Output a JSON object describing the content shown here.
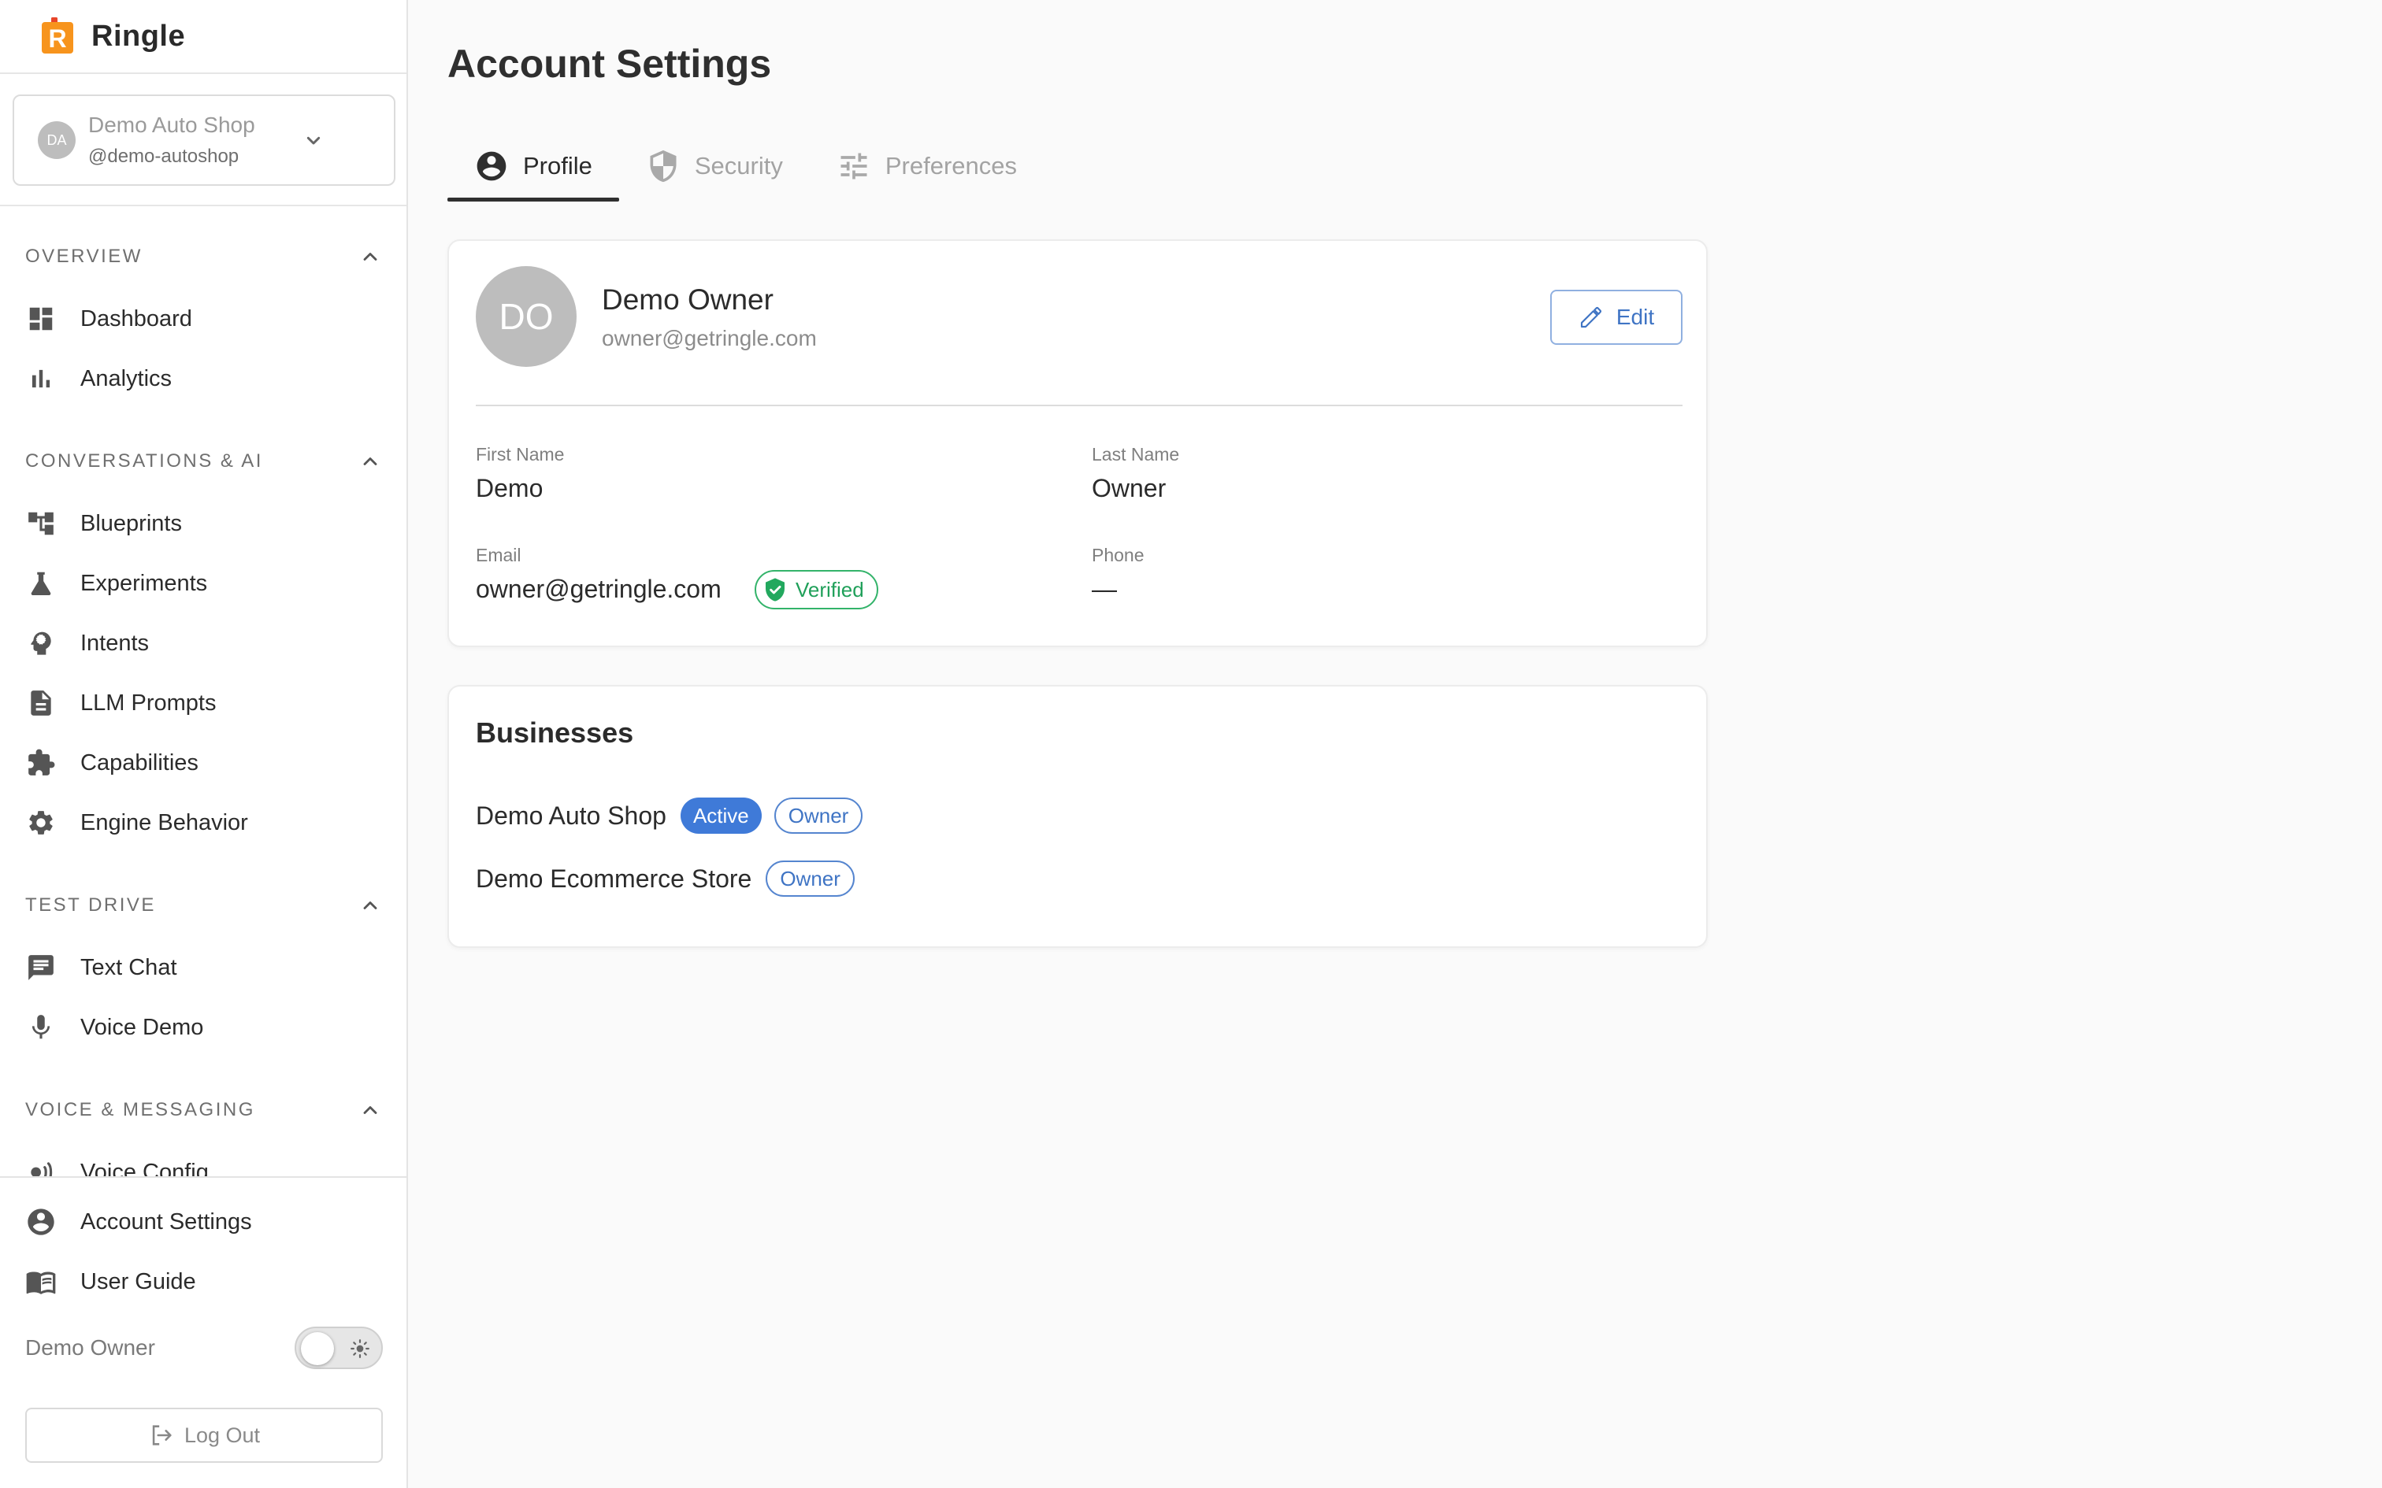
{
  "brand": {
    "name": "Ringle",
    "logo_letter": "R"
  },
  "org_switcher": {
    "avatar": "DA",
    "name": "Demo Auto Shop",
    "handle": "@demo-autoshop"
  },
  "nav": {
    "sections": [
      {
        "title": "OVERVIEW",
        "items": [
          {
            "label": "Dashboard",
            "icon": "dashboard-icon"
          },
          {
            "label": "Analytics",
            "icon": "bar-chart-icon"
          }
        ]
      },
      {
        "title": "CONVERSATIONS & AI",
        "items": [
          {
            "label": "Blueprints",
            "icon": "account-tree-icon"
          },
          {
            "label": "Experiments",
            "icon": "flask-icon"
          },
          {
            "label": "Intents",
            "icon": "psychology-icon"
          },
          {
            "label": "LLM Prompts",
            "icon": "document-icon"
          },
          {
            "label": "Capabilities",
            "icon": "puzzle-icon"
          },
          {
            "label": "Engine Behavior",
            "icon": "gear-icon"
          }
        ]
      },
      {
        "title": "TEST DRIVE",
        "items": [
          {
            "label": "Text Chat",
            "icon": "chat-icon"
          },
          {
            "label": "Voice Demo",
            "icon": "microphone-icon"
          }
        ]
      },
      {
        "title": "VOICE & MESSAGING",
        "items": [
          {
            "label": "Voice Config",
            "icon": "voice-icon"
          }
        ]
      }
    ]
  },
  "footer_nav": {
    "account_settings": "Account Settings",
    "user_guide": "User Guide",
    "user_name": "Demo Owner",
    "logout": "Log Out"
  },
  "page": {
    "title": "Account Settings"
  },
  "tabs": [
    {
      "label": "Profile",
      "icon": "account-circle-icon",
      "active": true
    },
    {
      "label": "Security",
      "icon": "shield-icon",
      "active": false
    },
    {
      "label": "Preferences",
      "icon": "tune-icon",
      "active": false
    }
  ],
  "profile": {
    "avatar": "DO",
    "name": "Demo Owner",
    "email": "owner@getringle.com",
    "edit_label": "Edit",
    "fields": {
      "first_name_label": "First Name",
      "first_name": "Demo",
      "last_name_label": "Last Name",
      "last_name": "Owner",
      "email_label": "Email",
      "email": "owner@getringle.com",
      "verified": "Verified",
      "phone_label": "Phone",
      "phone": "—"
    }
  },
  "businesses": {
    "title": "Businesses",
    "items": [
      {
        "name": "Demo Auto Shop",
        "active_label": "Active",
        "role": "Owner"
      },
      {
        "name": "Demo Ecommerce Store",
        "role": "Owner"
      }
    ]
  },
  "colors": {
    "accent_blue": "#3f7ad8",
    "verified_green": "#20a05a",
    "brand_orange": "#f28c1c"
  }
}
